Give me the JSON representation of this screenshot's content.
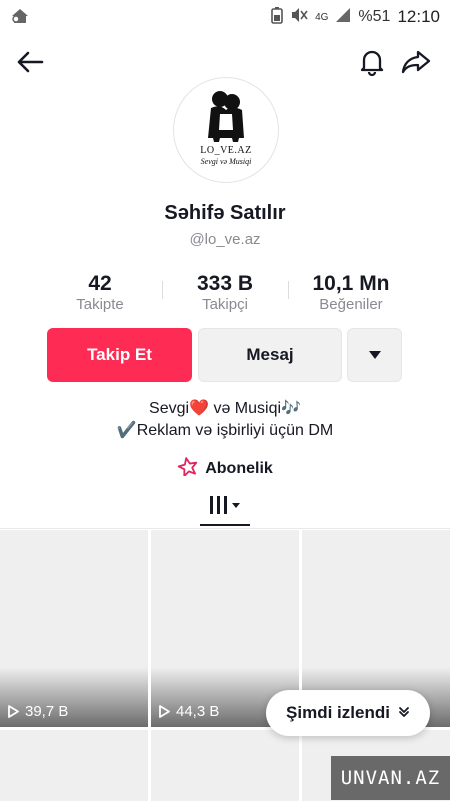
{
  "status_bar": {
    "network": "4G",
    "battery": "%51",
    "time": "12:10",
    "icons": [
      "home-notification-icon",
      "battery-saver-icon",
      "mute-icon",
      "signal-icon"
    ]
  },
  "topbar": {
    "back_icon": "arrow-left-icon",
    "bell_icon": "bell-icon",
    "share_icon": "share-arrow-icon"
  },
  "profile": {
    "avatar_logo_line1": "LO_VE.AZ",
    "avatar_logo_line2": "Sevgi və Musiqi",
    "display_name": "Səhifə Satılır",
    "username": "@lo_ve.az"
  },
  "stats": [
    {
      "value": "42",
      "label": "Takipte"
    },
    {
      "value": "333 B",
      "label": "Takipçi"
    },
    {
      "value": "10,1 Mn",
      "label": "Beğeniler"
    }
  ],
  "actions": {
    "follow_label": "Takip Et",
    "message_label": "Mesaj",
    "more_icon": "caret-down-icon"
  },
  "bio": {
    "line1": "Sevgi❤️ və Musiqi🎶",
    "line2": "✔️Reklam və işbirliyi üçün DM"
  },
  "subscription": {
    "icon": "subscription-star-icon",
    "label": "Abonelik"
  },
  "tabs": {
    "videos_icon": "video-grid-icon"
  },
  "videos": [
    {
      "views": "39,7 B"
    },
    {
      "views": "44,3 B"
    },
    {
      "views": ""
    }
  ],
  "now_watching": {
    "label": "Şimdi izlendi",
    "icon": "double-chevron-down-icon"
  },
  "watermark": "UNVAN.AZ",
  "colors": {
    "accent": "#fe2c55",
    "button_gray": "#f1f1f2",
    "secondary_text": "#8a8b91"
  }
}
